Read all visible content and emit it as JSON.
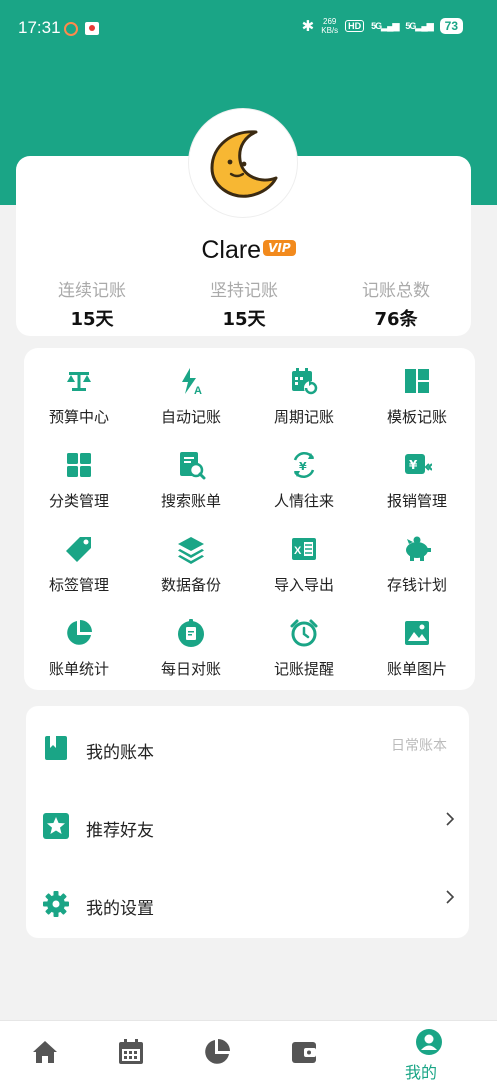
{
  "status_bar": {
    "time": "17:31",
    "network_speed": "269\nKB/s",
    "hd_label": "HD",
    "signal1": "5G",
    "signal2": "5G",
    "battery": "73"
  },
  "profile": {
    "username": "Clare",
    "vip_badge": "VIP",
    "stats": [
      {
        "label": "连续记账",
        "value": "15天"
      },
      {
        "label": "坚持记账",
        "value": "15天"
      },
      {
        "label": "记账总数",
        "value": "76条"
      }
    ]
  },
  "features": [
    {
      "label": "预算中心",
      "icon": "scale-icon"
    },
    {
      "label": "自动记账",
      "icon": "auto-icon"
    },
    {
      "label": "周期记账",
      "icon": "calendar-cycle-icon"
    },
    {
      "label": "模板记账",
      "icon": "template-icon"
    },
    {
      "label": "分类管理",
      "icon": "category-icon"
    },
    {
      "label": "搜索账单",
      "icon": "search-bill-icon"
    },
    {
      "label": "人情往来",
      "icon": "exchange-icon"
    },
    {
      "label": "报销管理",
      "icon": "reimburse-icon"
    },
    {
      "label": "标签管理",
      "icon": "tag-icon"
    },
    {
      "label": "数据备份",
      "icon": "layers-icon"
    },
    {
      "label": "导入导出",
      "icon": "excel-icon"
    },
    {
      "label": "存钱计划",
      "icon": "piggy-bank-icon"
    },
    {
      "label": "账单统计",
      "icon": "pie-chart-icon"
    },
    {
      "label": "每日对账",
      "icon": "daily-check-icon"
    },
    {
      "label": "记账提醒",
      "icon": "alarm-icon"
    },
    {
      "label": "账单图片",
      "icon": "image-icon"
    }
  ],
  "menu": {
    "my_book": {
      "label": "我的账本",
      "value": "日常账本"
    },
    "recommend": {
      "label": "推荐好友"
    },
    "settings": {
      "label": "我的设置"
    }
  },
  "bottom_nav": {
    "active_label": "我的"
  },
  "colors": {
    "primary": "#1aa586",
    "vip": "#f28a1d"
  }
}
